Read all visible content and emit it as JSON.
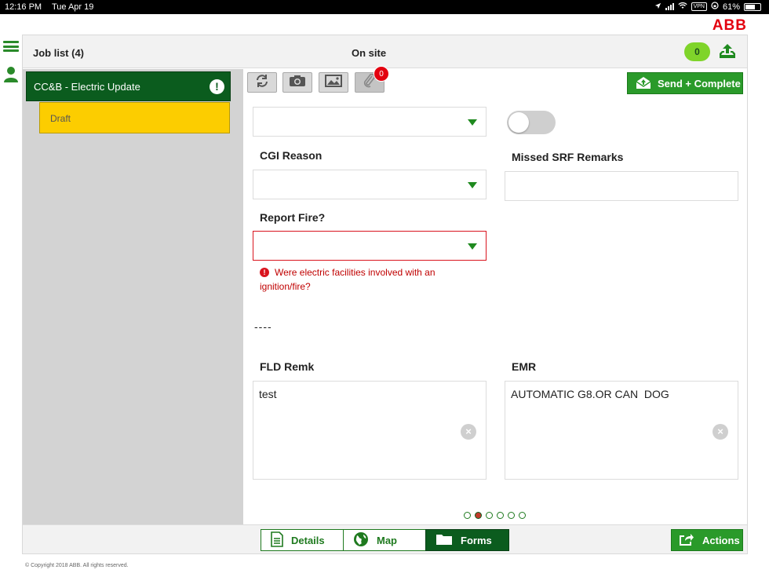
{
  "status_bar": {
    "time": "12:16 PM",
    "date": "Tue Apr 19",
    "vpn": "VPN",
    "battery": "61%"
  },
  "brand": {
    "logo_text": "ABB",
    "color": "#e3000f"
  },
  "header": {
    "job_list": "Job list (4)",
    "title": "On site",
    "sync_count": "0"
  },
  "sidebar": {
    "job": {
      "label": "CC&B - Electric Update",
      "alert": "!"
    },
    "status": "Draft"
  },
  "toolbar": {
    "attachment_count": "0",
    "send_label": "Send + Complete",
    "icons": [
      "refresh-icon",
      "camera-icon",
      "image-icon",
      "paperclip-icon"
    ]
  },
  "form": {
    "cgi_reason_label": "CGI Reason",
    "missed_srf_label": "Missed SRF Remarks",
    "report_fire_label": "Report Fire?",
    "report_fire_error": "Were electric facilities involved with an ignition/fire?",
    "separator": "----",
    "fld_remk_label": "FLD Remk",
    "fld_remk_value": "test",
    "emr_label": "EMR",
    "emr_value": "AUTOMATIC G8.OR CAN  DOG",
    "toggle_on": false
  },
  "pager": {
    "count": 6,
    "active_index": 1
  },
  "bottom_tabs": [
    {
      "label": "Details",
      "active": false
    },
    {
      "label": "Map",
      "active": false
    },
    {
      "label": "Forms",
      "active": true
    }
  ],
  "actions_label": "Actions",
  "footer": "© Copyright 2018 ABB. All rights reserved.",
  "colors": {
    "primary_green": "#0b5c1e",
    "button_green": "#2a9a2a",
    "draft_yellow": "#fccd00",
    "error_red": "#d9141e"
  }
}
